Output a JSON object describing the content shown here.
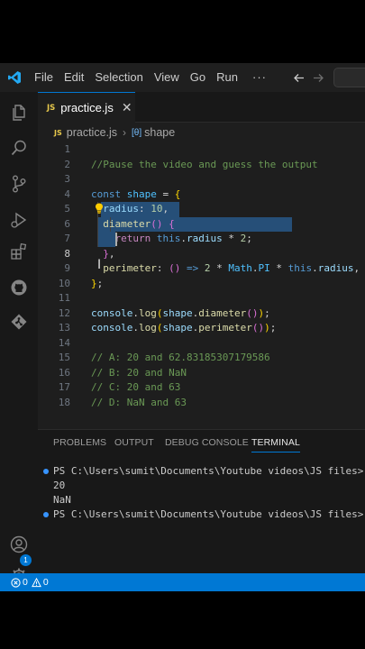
{
  "title_bar": {
    "menu": [
      "File",
      "Edit",
      "Selection",
      "View",
      "Go",
      "Run"
    ],
    "more": "···",
    "back_icon": "arrow-left-icon",
    "forward_icon": "arrow-right-icon"
  },
  "activity_bar": {
    "icons": [
      "explorer-icon",
      "search-icon",
      "source-control-icon",
      "run-debug-icon",
      "extensions-icon",
      "github-icon",
      "git-graph-icon",
      "accounts-icon",
      "settings-gear-icon"
    ],
    "settings_badge": "1"
  },
  "tabs": [
    {
      "badge": "JS",
      "label": "practice.js",
      "close": "✕",
      "active": true
    }
  ],
  "breadcrumb": {
    "file_badge": "JS",
    "file": "practice.js",
    "separator": "›",
    "symbol_icon": "[θ]",
    "symbol": "shape"
  },
  "editor": {
    "line_numbers": [
      "1",
      "2",
      "3",
      "4",
      "5",
      "6",
      "7",
      "8",
      "9",
      "10",
      "11",
      "12",
      "13",
      "14",
      "15",
      "16",
      "17",
      "18"
    ],
    "active_line": 8,
    "lines": [
      [],
      [
        [
          "c-comment",
          "//Pause the video and guess the output"
        ]
      ],
      [],
      [
        [
          "c-kw",
          "const"
        ],
        [
          "c-op",
          " "
        ],
        [
          "c-const",
          "shape"
        ],
        [
          "c-op",
          " = "
        ],
        [
          "c-br1",
          "{"
        ]
      ],
      [
        [
          "c-op",
          "  "
        ],
        [
          "c-var",
          "radius"
        ],
        [
          "c-op",
          ": "
        ],
        [
          "c-num",
          "10"
        ],
        [
          "c-op",
          ","
        ]
      ],
      [
        [
          "c-op",
          "  "
        ],
        [
          "c-fn",
          "diameter"
        ],
        [
          "c-br2",
          "()"
        ],
        [
          "c-op",
          " "
        ],
        [
          "c-br2",
          "{"
        ]
      ],
      [
        [
          "c-op",
          "    "
        ],
        [
          "c-ctrl",
          "return"
        ],
        [
          "c-op",
          " "
        ],
        [
          "c-kw",
          "this"
        ],
        [
          "c-op",
          "."
        ],
        [
          "c-var",
          "radius"
        ],
        [
          "c-op",
          " * "
        ],
        [
          "c-num",
          "2"
        ],
        [
          "c-op",
          ";"
        ]
      ],
      [
        [
          "c-op",
          "  "
        ],
        [
          "c-br2",
          "}"
        ],
        [
          "c-op",
          ","
        ]
      ],
      [
        [
          "c-op",
          "  "
        ],
        [
          "c-fn",
          "perimeter"
        ],
        [
          "c-op",
          ": "
        ],
        [
          "c-br2",
          "()"
        ],
        [
          "c-op",
          " "
        ],
        [
          "c-kw",
          "=>"
        ],
        [
          "c-op",
          " "
        ],
        [
          "c-num",
          "2"
        ],
        [
          "c-op",
          " * "
        ],
        [
          "c-const",
          "Math"
        ],
        [
          "c-op",
          "."
        ],
        [
          "c-const",
          "PI"
        ],
        [
          "c-op",
          " * "
        ],
        [
          "c-kw",
          "this"
        ],
        [
          "c-op",
          "."
        ],
        [
          "c-var",
          "radius"
        ],
        [
          "c-op",
          ","
        ]
      ],
      [
        [
          "c-br1",
          "}"
        ],
        [
          "c-op",
          ";"
        ]
      ],
      [],
      [
        [
          "c-var",
          "console"
        ],
        [
          "c-op",
          "."
        ],
        [
          "c-fn",
          "log"
        ],
        [
          "c-br1",
          "("
        ],
        [
          "c-var",
          "shape"
        ],
        [
          "c-op",
          "."
        ],
        [
          "c-fn",
          "diameter"
        ],
        [
          "c-br2",
          "()"
        ],
        [
          "c-br1",
          ")"
        ],
        [
          "c-op",
          ";"
        ]
      ],
      [
        [
          "c-var",
          "console"
        ],
        [
          "c-op",
          "."
        ],
        [
          "c-fn",
          "log"
        ],
        [
          "c-br1",
          "("
        ],
        [
          "c-var",
          "shape"
        ],
        [
          "c-op",
          "."
        ],
        [
          "c-fn",
          "perimeter"
        ],
        [
          "c-br2",
          "()"
        ],
        [
          "c-br1",
          ")"
        ],
        [
          "c-op",
          ";"
        ]
      ],
      [],
      [
        [
          "c-comment",
          "// A: 20 and 62.83185307179586"
        ]
      ],
      [
        [
          "c-comment",
          "// B: 20 and NaN"
        ]
      ],
      [
        [
          "c-comment",
          "// C: 20 and 63"
        ]
      ],
      [
        [
          "c-comment",
          "// D: NaN and 63"
        ]
      ]
    ]
  },
  "panel": {
    "tabs": [
      "PROBLEMS",
      "OUTPUT",
      "DEBUG CONSOLE",
      "TERMINAL"
    ],
    "active_tab": "TERMINAL",
    "terminal": [
      {
        "dot": "#3794ff",
        "text": "PS C:\\Users\\sumit\\Documents\\Youtube videos\\JS files> node"
      },
      {
        "dot": "",
        "text": "20"
      },
      {
        "dot": "",
        "text": "NaN"
      },
      {
        "dot": "#3794ff",
        "text": "PS C:\\Users\\sumit\\Documents\\Youtube videos\\JS files> "
      }
    ]
  },
  "status_bar": {
    "errors": "0",
    "warnings": "0",
    "error_icon": "error-icon",
    "warning_icon": "warning-icon"
  }
}
